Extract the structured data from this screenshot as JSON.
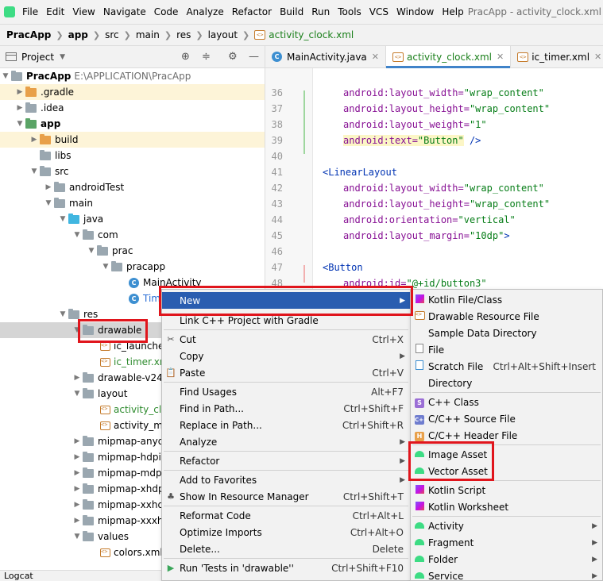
{
  "menubar": {
    "items": [
      "File",
      "Edit",
      "View",
      "Navigate",
      "Code",
      "Analyze",
      "Refactor",
      "Build",
      "Run",
      "Tools",
      "VCS",
      "Window",
      "Help"
    ],
    "window_title": "PracApp - activity_clock.xml"
  },
  "breadcrumb": [
    "PracApp",
    "app",
    "src",
    "main",
    "res",
    "layout",
    "activity_clock.xml"
  ],
  "project_panel": {
    "title": "Project"
  },
  "tree": [
    {
      "label": "PracApp",
      "extra": "E:\\APPLICATION\\PracApp"
    },
    {
      "label": ".gradle"
    },
    {
      "label": ".idea"
    },
    {
      "label": "app"
    },
    {
      "label": "build"
    },
    {
      "label": "libs"
    },
    {
      "label": "src"
    },
    {
      "label": "androidTest"
    },
    {
      "label": "main"
    },
    {
      "label": "java"
    },
    {
      "label": "com"
    },
    {
      "label": "prac"
    },
    {
      "label": "pracapp"
    },
    {
      "label": "MainActivity"
    },
    {
      "label": "Tim"
    },
    {
      "label": "res"
    },
    {
      "label": "drawable"
    },
    {
      "label": "ic_launcher"
    },
    {
      "label": "ic_timer.xm"
    },
    {
      "label": "drawable-v24"
    },
    {
      "label": "layout"
    },
    {
      "label": "activity_clo"
    },
    {
      "label": "activity_ma"
    },
    {
      "label": "mipmap-anyd"
    },
    {
      "label": "mipmap-hdpi"
    },
    {
      "label": "mipmap-mdp"
    },
    {
      "label": "mipmap-xhdp"
    },
    {
      "label": "mipmap-xxhd"
    },
    {
      "label": "mipmap-xxxh"
    },
    {
      "label": "values"
    },
    {
      "label": "colors.xml"
    }
  ],
  "bottom": {
    "logcat": "Logcat"
  },
  "tabs": [
    {
      "label": "MainActivity.java"
    },
    {
      "label": "activity_clock.xml"
    },
    {
      "label": "ic_timer.xml"
    }
  ],
  "editor": {
    "line_numbers": [
      "36",
      "37",
      "38",
      "39",
      "40",
      "41",
      "42",
      "43",
      "44",
      "45",
      "46",
      "47",
      "48"
    ],
    "lines": [
      {
        "attr": "android:layout_width=",
        "val": "\"wrap_content\""
      },
      {
        "attr": "android:layout_height=",
        "val": "\"wrap_content\""
      },
      {
        "attr": "android:layout_weight=",
        "val": "\"1\""
      },
      {
        "attr": "android:text=",
        "val": "\"Button\"",
        "rest": " />"
      },
      {
        "tag": ""
      },
      {
        "tag": "<LinearLayout"
      },
      {
        "attr": "android:layout_width=",
        "val": "\"wrap_content\""
      },
      {
        "attr": "android:layout_height=",
        "val": "\"wrap_content\""
      },
      {
        "attr": "android:orientation=",
        "val": "\"vertical\""
      },
      {
        "attr": "android:layout_margin=",
        "val": "\"10dp\"",
        "rest": ">"
      },
      {
        "tag": ""
      },
      {
        "tag": "<Button"
      },
      {
        "attr": "android:id=",
        "val": "\"@+id/button3\""
      }
    ]
  },
  "context_menu": {
    "items": [
      {
        "label": "New"
      },
      {
        "label": "Link C++ Project with Gradle"
      },
      {
        "label": "Cut",
        "shortcut": "Ctrl+X"
      },
      {
        "label": "Copy"
      },
      {
        "label": "Paste",
        "shortcut": "Ctrl+V"
      },
      {
        "label": "Find Usages",
        "shortcut": "Alt+F7"
      },
      {
        "label": "Find in Path...",
        "shortcut": "Ctrl+Shift+F"
      },
      {
        "label": "Replace in Path...",
        "shortcut": "Ctrl+Shift+R"
      },
      {
        "label": "Analyze"
      },
      {
        "label": "Refactor"
      },
      {
        "label": "Add to Favorites"
      },
      {
        "label": "Show In Resource Manager",
        "shortcut": "Ctrl+Shift+T"
      },
      {
        "label": "Reformat Code",
        "shortcut": "Ctrl+Alt+L"
      },
      {
        "label": "Optimize Imports",
        "shortcut": "Ctrl+Alt+O"
      },
      {
        "label": "Delete...",
        "shortcut": "Delete"
      },
      {
        "label": "Run 'Tests in 'drawable''",
        "shortcut": "Ctrl+Shift+F10"
      }
    ]
  },
  "submenu": {
    "items": [
      {
        "label": "Kotlin File/Class"
      },
      {
        "label": "Drawable Resource File"
      },
      {
        "label": "Sample Data Directory"
      },
      {
        "label": "File"
      },
      {
        "label": "Scratch File",
        "shortcut": "Ctrl+Alt+Shift+Insert"
      },
      {
        "label": "Directory"
      },
      {
        "label": "C++ Class"
      },
      {
        "label": "C/C++ Source File"
      },
      {
        "label": "C/C++ Header File"
      },
      {
        "label": "Image Asset"
      },
      {
        "label": "Vector Asset"
      },
      {
        "label": "Kotlin Script"
      },
      {
        "label": "Kotlin Worksheet"
      },
      {
        "label": "Activity"
      },
      {
        "label": "Fragment"
      },
      {
        "label": "Folder"
      },
      {
        "label": "Service"
      }
    ]
  },
  "colors": {
    "highlight_box": "#e0151c",
    "menu_selected": "#2a5db0",
    "android_green": "#3ddc84"
  }
}
